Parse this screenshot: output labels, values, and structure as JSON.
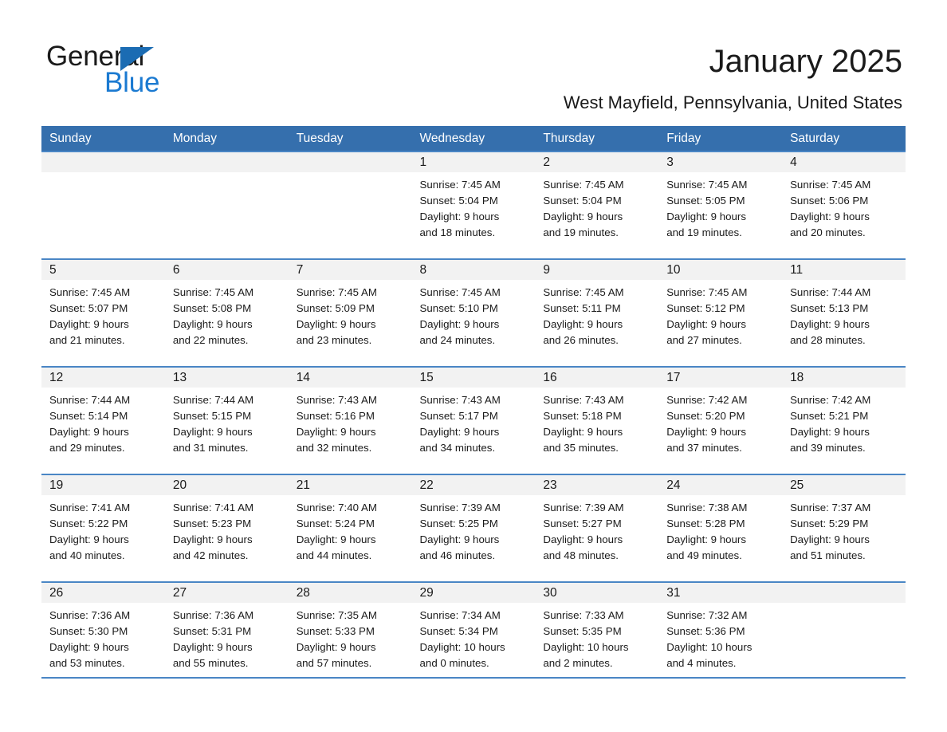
{
  "brand": {
    "logo_text_top": "General",
    "logo_text_bottom": "Blue",
    "logo_black": "#1a1a1a",
    "logo_blue": "#1b7ad1",
    "triangle_blue": "#1b6cb3"
  },
  "header": {
    "title": "January 2025",
    "subtitle": "West Mayfield, Pennsylvania, United States"
  },
  "theme": {
    "header_row_blue": "#356fad",
    "row_rule_blue": "#4a86c5",
    "daynum_band_gray": "#f2f2f2",
    "text_black": "#1a1a1a",
    "page_background": "#ffffff"
  },
  "calendar": {
    "weekday_headers": [
      "Sunday",
      "Monday",
      "Tuesday",
      "Wednesday",
      "Thursday",
      "Friday",
      "Saturday"
    ],
    "weeks": [
      [
        {
          "day": "",
          "lines": []
        },
        {
          "day": "",
          "lines": []
        },
        {
          "day": "",
          "lines": []
        },
        {
          "day": "1",
          "lines": [
            "Sunrise: 7:45 AM",
            "Sunset: 5:04 PM",
            "Daylight: 9 hours",
            "and 18 minutes."
          ]
        },
        {
          "day": "2",
          "lines": [
            "Sunrise: 7:45 AM",
            "Sunset: 5:04 PM",
            "Daylight: 9 hours",
            "and 19 minutes."
          ]
        },
        {
          "day": "3",
          "lines": [
            "Sunrise: 7:45 AM",
            "Sunset: 5:05 PM",
            "Daylight: 9 hours",
            "and 19 minutes."
          ]
        },
        {
          "day": "4",
          "lines": [
            "Sunrise: 7:45 AM",
            "Sunset: 5:06 PM",
            "Daylight: 9 hours",
            "and 20 minutes."
          ]
        }
      ],
      [
        {
          "day": "5",
          "lines": [
            "Sunrise: 7:45 AM",
            "Sunset: 5:07 PM",
            "Daylight: 9 hours",
            "and 21 minutes."
          ]
        },
        {
          "day": "6",
          "lines": [
            "Sunrise: 7:45 AM",
            "Sunset: 5:08 PM",
            "Daylight: 9 hours",
            "and 22 minutes."
          ]
        },
        {
          "day": "7",
          "lines": [
            "Sunrise: 7:45 AM",
            "Sunset: 5:09 PM",
            "Daylight: 9 hours",
            "and 23 minutes."
          ]
        },
        {
          "day": "8",
          "lines": [
            "Sunrise: 7:45 AM",
            "Sunset: 5:10 PM",
            "Daylight: 9 hours",
            "and 24 minutes."
          ]
        },
        {
          "day": "9",
          "lines": [
            "Sunrise: 7:45 AM",
            "Sunset: 5:11 PM",
            "Daylight: 9 hours",
            "and 26 minutes."
          ]
        },
        {
          "day": "10",
          "lines": [
            "Sunrise: 7:45 AM",
            "Sunset: 5:12 PM",
            "Daylight: 9 hours",
            "and 27 minutes."
          ]
        },
        {
          "day": "11",
          "lines": [
            "Sunrise: 7:44 AM",
            "Sunset: 5:13 PM",
            "Daylight: 9 hours",
            "and 28 minutes."
          ]
        }
      ],
      [
        {
          "day": "12",
          "lines": [
            "Sunrise: 7:44 AM",
            "Sunset: 5:14 PM",
            "Daylight: 9 hours",
            "and 29 minutes."
          ]
        },
        {
          "day": "13",
          "lines": [
            "Sunrise: 7:44 AM",
            "Sunset: 5:15 PM",
            "Daylight: 9 hours",
            "and 31 minutes."
          ]
        },
        {
          "day": "14",
          "lines": [
            "Sunrise: 7:43 AM",
            "Sunset: 5:16 PM",
            "Daylight: 9 hours",
            "and 32 minutes."
          ]
        },
        {
          "day": "15",
          "lines": [
            "Sunrise: 7:43 AM",
            "Sunset: 5:17 PM",
            "Daylight: 9 hours",
            "and 34 minutes."
          ]
        },
        {
          "day": "16",
          "lines": [
            "Sunrise: 7:43 AM",
            "Sunset: 5:18 PM",
            "Daylight: 9 hours",
            "and 35 minutes."
          ]
        },
        {
          "day": "17",
          "lines": [
            "Sunrise: 7:42 AM",
            "Sunset: 5:20 PM",
            "Daylight: 9 hours",
            "and 37 minutes."
          ]
        },
        {
          "day": "18",
          "lines": [
            "Sunrise: 7:42 AM",
            "Sunset: 5:21 PM",
            "Daylight: 9 hours",
            "and 39 minutes."
          ]
        }
      ],
      [
        {
          "day": "19",
          "lines": [
            "Sunrise: 7:41 AM",
            "Sunset: 5:22 PM",
            "Daylight: 9 hours",
            "and 40 minutes."
          ]
        },
        {
          "day": "20",
          "lines": [
            "Sunrise: 7:41 AM",
            "Sunset: 5:23 PM",
            "Daylight: 9 hours",
            "and 42 minutes."
          ]
        },
        {
          "day": "21",
          "lines": [
            "Sunrise: 7:40 AM",
            "Sunset: 5:24 PM",
            "Daylight: 9 hours",
            "and 44 minutes."
          ]
        },
        {
          "day": "22",
          "lines": [
            "Sunrise: 7:39 AM",
            "Sunset: 5:25 PM",
            "Daylight: 9 hours",
            "and 46 minutes."
          ]
        },
        {
          "day": "23",
          "lines": [
            "Sunrise: 7:39 AM",
            "Sunset: 5:27 PM",
            "Daylight: 9 hours",
            "and 48 minutes."
          ]
        },
        {
          "day": "24",
          "lines": [
            "Sunrise: 7:38 AM",
            "Sunset: 5:28 PM",
            "Daylight: 9 hours",
            "and 49 minutes."
          ]
        },
        {
          "day": "25",
          "lines": [
            "Sunrise: 7:37 AM",
            "Sunset: 5:29 PM",
            "Daylight: 9 hours",
            "and 51 minutes."
          ]
        }
      ],
      [
        {
          "day": "26",
          "lines": [
            "Sunrise: 7:36 AM",
            "Sunset: 5:30 PM",
            "Daylight: 9 hours",
            "and 53 minutes."
          ]
        },
        {
          "day": "27",
          "lines": [
            "Sunrise: 7:36 AM",
            "Sunset: 5:31 PM",
            "Daylight: 9 hours",
            "and 55 minutes."
          ]
        },
        {
          "day": "28",
          "lines": [
            "Sunrise: 7:35 AM",
            "Sunset: 5:33 PM",
            "Daylight: 9 hours",
            "and 57 minutes."
          ]
        },
        {
          "day": "29",
          "lines": [
            "Sunrise: 7:34 AM",
            "Sunset: 5:34 PM",
            "Daylight: 10 hours",
            "and 0 minutes."
          ]
        },
        {
          "day": "30",
          "lines": [
            "Sunrise: 7:33 AM",
            "Sunset: 5:35 PM",
            "Daylight: 10 hours",
            "and 2 minutes."
          ]
        },
        {
          "day": "31",
          "lines": [
            "Sunrise: 7:32 AM",
            "Sunset: 5:36 PM",
            "Daylight: 10 hours",
            "and 4 minutes."
          ]
        },
        {
          "day": "",
          "lines": []
        }
      ]
    ]
  }
}
